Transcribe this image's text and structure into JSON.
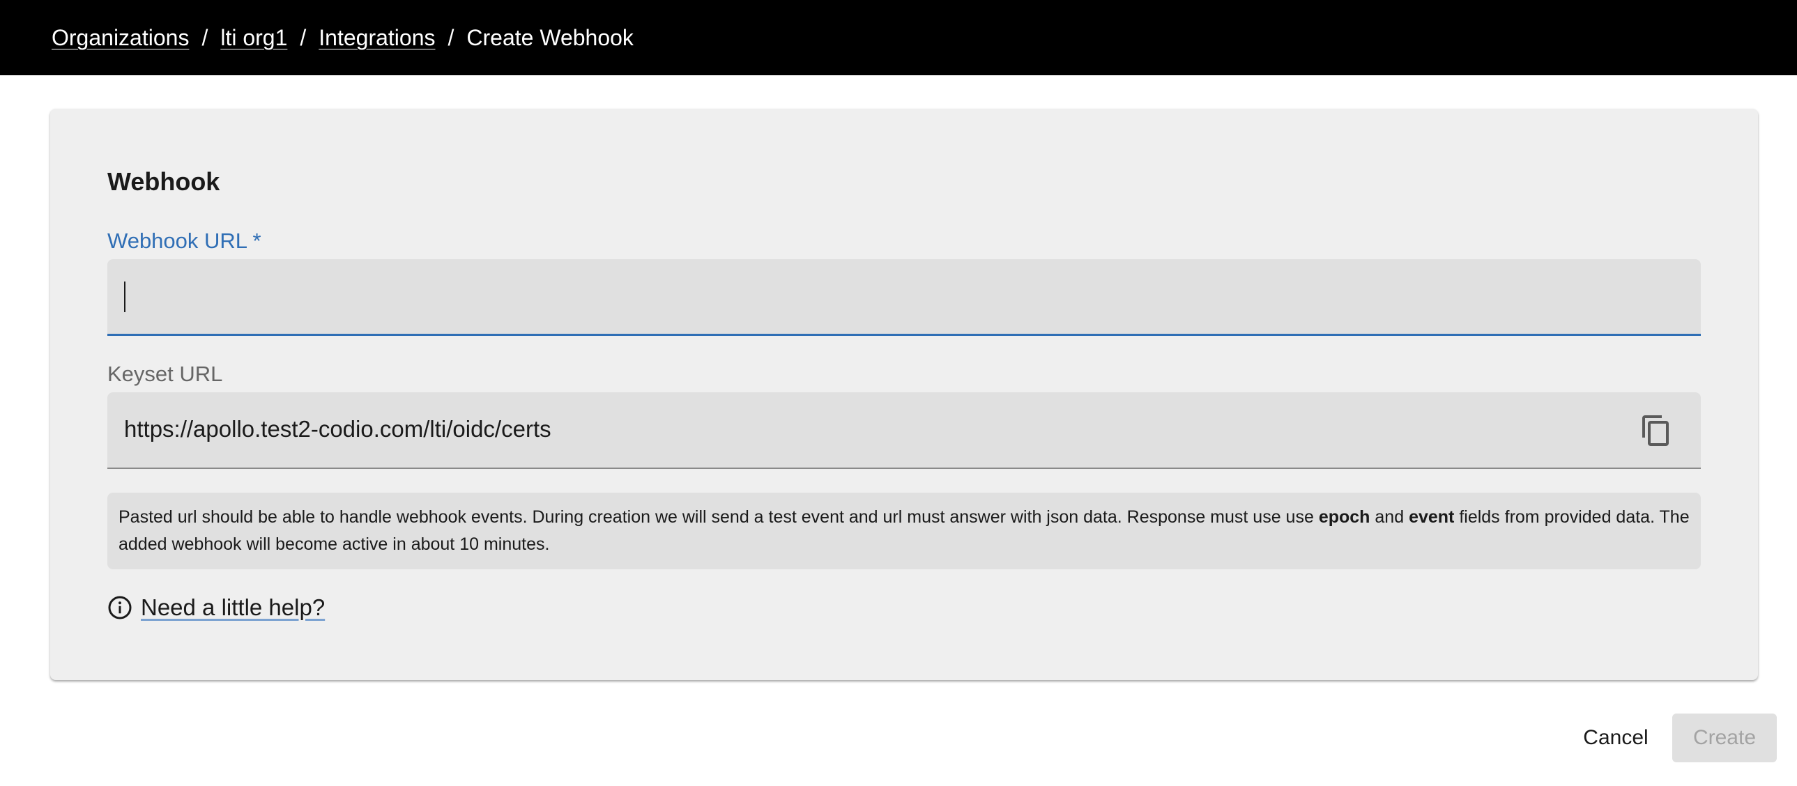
{
  "breadcrumb": {
    "items": [
      {
        "label": "Organizations"
      },
      {
        "label": "lti org1"
      },
      {
        "label": "Integrations"
      }
    ],
    "separator": "/",
    "current": "Create Webhook"
  },
  "form": {
    "section_title": "Webhook",
    "webhook_url": {
      "label": "Webhook URL *",
      "value": "",
      "placeholder": ""
    },
    "keyset_url": {
      "label": "Keyset URL",
      "value": "https://apollo.test2-codio.com/lti/oidc/certs",
      "copy_icon": "copy-icon"
    },
    "info": {
      "part1": "Pasted url should be able to handle webhook events. During creation we will send a test event and url must answer with json data. Response must use use ",
      "bold1": "epoch",
      "part2": " and ",
      "bold2": "event",
      "part3": " fields from provided data. The added webhook will become active in about 10 minutes."
    },
    "help": {
      "icon": "info-circle-icon",
      "label": "Need a little help?"
    }
  },
  "actions": {
    "cancel_label": "Cancel",
    "create_label": "Create"
  },
  "colors": {
    "topbar": "#000000",
    "accent": "#2f6eb5",
    "card": "#efefef",
    "field": "#e0e0e0"
  }
}
